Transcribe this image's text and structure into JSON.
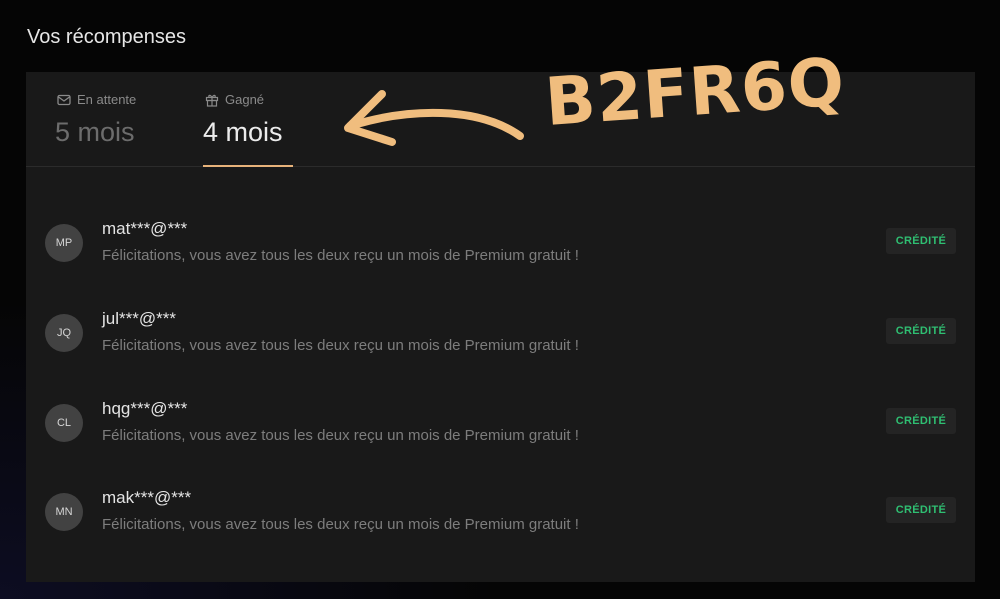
{
  "page": {
    "title": "Vos récompenses"
  },
  "tabs": {
    "pending": {
      "icon": "mail-icon",
      "label": "En attente",
      "value": "5 mois"
    },
    "earned": {
      "icon": "gift-icon",
      "label": "Gagné",
      "value": "4 mois",
      "active": true
    }
  },
  "rewards": [
    {
      "initials": "MP",
      "user": "mat***@***",
      "message": "Félicitations, vous avez tous les deux reçu un mois de Premium gratuit !",
      "status": "CRÉDITÉ"
    },
    {
      "initials": "JQ",
      "user": "jul***@***",
      "message": "Félicitations, vous avez tous les deux reçu un mois de Premium gratuit !",
      "status": "CRÉDITÉ"
    },
    {
      "initials": "CL",
      "user": "hqg***@***",
      "message": "Félicitations, vous avez tous les deux reçu un mois de Premium gratuit !",
      "status": "CRÉDITÉ"
    },
    {
      "initials": "MN",
      "user": "mak***@***",
      "message": "Félicitations, vous avez tous les deux reçu un mois de Premium gratuit !",
      "status": "CRÉDITÉ"
    }
  ],
  "annotation": {
    "code": "B2FR6Q",
    "icon": "arrow-left-icon"
  },
  "colors": {
    "accent": "#e7b27a",
    "success": "#2fbf72",
    "panel": "#191919",
    "annotation": "#f0bd7e"
  }
}
